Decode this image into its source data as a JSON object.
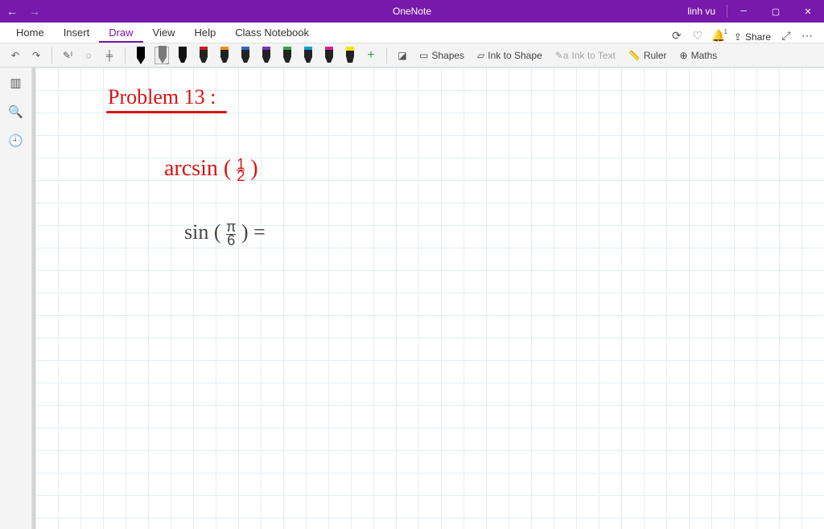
{
  "titlebar": {
    "app_title": "OneNote",
    "user": "linh vu"
  },
  "menu": {
    "home": "Home",
    "insert": "Insert",
    "draw": "Draw",
    "view": "View",
    "help": "Help",
    "class_notebook": "Class Notebook",
    "share": "Share"
  },
  "toolbar": {
    "shapes": "Shapes",
    "ink_to_shape": "Ink to Shape",
    "ink_to_text": "Ink to Text",
    "ruler": "Ruler",
    "maths": "Maths",
    "pens": [
      {
        "color": "#000000",
        "type": "pen"
      },
      {
        "color": "#7a7a7a",
        "type": "pen",
        "active": true
      },
      {
        "color": "#111111",
        "type": "marker"
      },
      {
        "color": "#d11919",
        "type": "marker"
      },
      {
        "color": "#ff8c00",
        "type": "marker"
      },
      {
        "color": "#2e67c8",
        "type": "marker"
      },
      {
        "color": "#7b2fbf",
        "type": "marker"
      },
      {
        "color": "#2aa84a",
        "type": "marker"
      },
      {
        "color": "#0aa1d6",
        "type": "marker"
      },
      {
        "color": "#d11ea0",
        "type": "marker"
      },
      {
        "color": "#f5e400",
        "type": "highlighter"
      }
    ]
  },
  "handwriting": {
    "heading": "Problem 13 :",
    "line1": "arcsin ( ½ )",
    "line2": "sin ( π⁄6 ) ="
  }
}
